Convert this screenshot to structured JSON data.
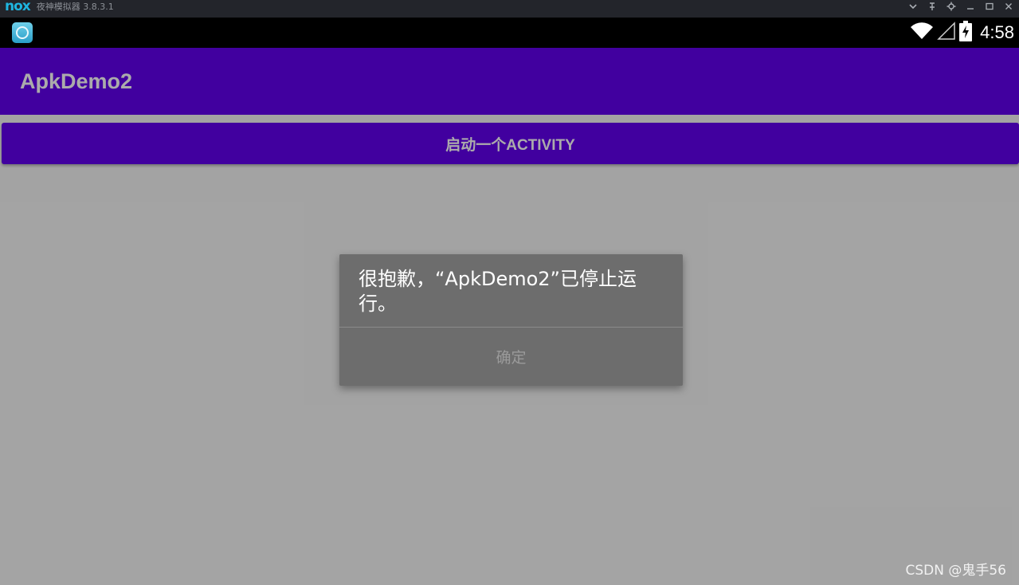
{
  "emulator": {
    "logo": "nox",
    "title": "夜神模拟器 3.8.3.1",
    "controls": [
      "chevron-down-icon",
      "pin-icon",
      "gear-icon",
      "minimize-icon",
      "maximize-icon",
      "close-icon"
    ]
  },
  "statusbar": {
    "time": "4:58",
    "icons": [
      "wifi-icon",
      "signal-icon",
      "battery-charging-icon"
    ]
  },
  "app": {
    "title": "ApkDemo2",
    "button_label": "启动一个ACTIVITY"
  },
  "dialog": {
    "message": "很抱歉，“ApkDemo2”已停止运行。",
    "ok_label": "确定"
  },
  "watermark": "CSDN @鬼手56",
  "colors": {
    "app_bar": "#6200ee",
    "dialog_bg": "#6d6d6d",
    "titlebar": "#23252b"
  }
}
